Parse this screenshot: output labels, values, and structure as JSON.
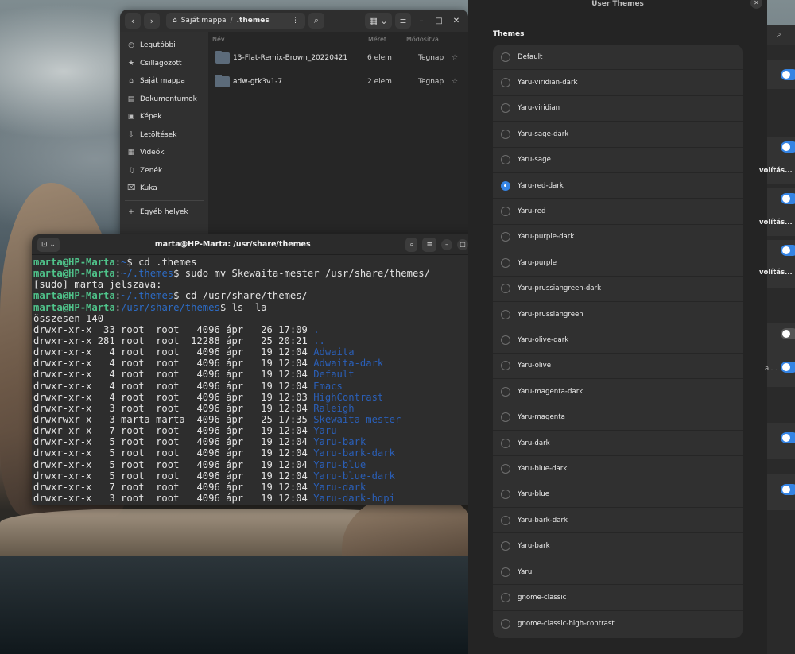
{
  "files": {
    "path_root": "Saját mappa",
    "path_current": ".themes",
    "sidebar": [
      {
        "icon": "clock-icon",
        "glyph": "◷",
        "label": "Legutóbbi"
      },
      {
        "icon": "star-icon",
        "glyph": "★",
        "label": "Csillagozott"
      },
      {
        "icon": "home-icon",
        "glyph": "⌂",
        "label": "Saját mappa"
      },
      {
        "icon": "document-icon",
        "glyph": "▤",
        "label": "Dokumentumok"
      },
      {
        "icon": "image-icon",
        "glyph": "▣",
        "label": "Képek"
      },
      {
        "icon": "download-icon",
        "glyph": "⇩",
        "label": "Letöltések"
      },
      {
        "icon": "video-icon",
        "glyph": "▦",
        "label": "Videók"
      },
      {
        "icon": "music-icon",
        "glyph": "♫",
        "label": "Zenék"
      },
      {
        "icon": "trash-icon",
        "glyph": "⌧",
        "label": "Kuka"
      }
    ],
    "other_places": "Egyéb helyek",
    "columns": {
      "name": "Név",
      "size": "Méret",
      "modified": "Módosítva"
    },
    "rows": [
      {
        "name": "13-Flat-Remix-Brown_20220421",
        "size": "6 elem",
        "modified": "Tegnap"
      },
      {
        "name": "adw-gtk3v1-7",
        "size": "2 elem",
        "modified": "Tegnap"
      }
    ]
  },
  "terminal": {
    "title": "marta@HP-Marta: /usr/share/themes",
    "lines": [
      {
        "user": "marta@HP-Marta",
        "path": "~",
        "cmd": "$ cd .themes"
      },
      {
        "user": "marta@HP-Marta",
        "path": "~/.themes",
        "cmd": "$ sudo mv Skewaita-mester /usr/share/themes/"
      },
      {
        "text": "[sudo] marta jelszava:"
      },
      {
        "user": "marta@HP-Marta",
        "path": "~/.themes",
        "cmd": "$ cd /usr/share/themes/"
      },
      {
        "user": "marta@HP-Marta",
        "path": "/usr/share/themes",
        "cmd": "$ ls -la"
      },
      {
        "text": "összesen 140"
      },
      {
        "text": "drwxr-xr-x  33 root  root   4096 ápr   26 17:09 ",
        "dir": "."
      },
      {
        "text": "drwxr-xr-x 281 root  root  12288 ápr   25 20:21 ",
        "dir": ".."
      },
      {
        "text": "drwxr-xr-x   4 root  root   4096 ápr   19 12:04 ",
        "dir": "Adwaita"
      },
      {
        "text": "drwxr-xr-x   4 root  root   4096 ápr   19 12:04 ",
        "dir": "Adwaita-dark"
      },
      {
        "text": "drwxr-xr-x   4 root  root   4096 ápr   19 12:04 ",
        "dir": "Default"
      },
      {
        "text": "drwxr-xr-x   4 root  root   4096 ápr   19 12:04 ",
        "dir": "Emacs"
      },
      {
        "text": "drwxr-xr-x   4 root  root   4096 ápr   19 12:03 ",
        "dir": "HighContrast"
      },
      {
        "text": "drwxr-xr-x   3 root  root   4096 ápr   19 12:04 ",
        "dir": "Raleigh"
      },
      {
        "text": "drwxrwxr-x   3 marta marta  4096 ápr   25 17:35 ",
        "dir": "Skewaita-mester"
      },
      {
        "text": "drwxr-xr-x   7 root  root   4096 ápr   19 12:04 ",
        "dir": "Yaru"
      },
      {
        "text": "drwxr-xr-x   5 root  root   4096 ápr   19 12:04 ",
        "dir": "Yaru-bark"
      },
      {
        "text": "drwxr-xr-x   5 root  root   4096 ápr   19 12:04 ",
        "dir": "Yaru-bark-dark"
      },
      {
        "text": "drwxr-xr-x   5 root  root   4096 ápr   19 12:04 ",
        "dir": "Yaru-blue"
      },
      {
        "text": "drwxr-xr-x   5 root  root   4096 ápr   19 12:04 ",
        "dir": "Yaru-blue-dark"
      },
      {
        "text": "drwxr-xr-x   7 root  root   4096 ápr   19 12:04 ",
        "dir": "Yaru-dark"
      },
      {
        "text": "drwxr-xr-x   3 root  root   4096 ápr   19 12:04 ",
        "dir": "Yaru-dark-hdpi"
      }
    ]
  },
  "user_themes": {
    "window_title": "User Themes",
    "section_title": "Themes",
    "selected": "Yaru-red-dark",
    "items": [
      "Default",
      "Yaru-viridian-dark",
      "Yaru-viridian",
      "Yaru-sage-dark",
      "Yaru-sage",
      "Yaru-red-dark",
      "Yaru-red",
      "Yaru-purple-dark",
      "Yaru-purple",
      "Yaru-prussiangreen-dark",
      "Yaru-prussiangreen",
      "Yaru-olive-dark",
      "Yaru-olive",
      "Yaru-magenta-dark",
      "Yaru-magenta",
      "Yaru-dark",
      "Yaru-blue-dark",
      "Yaru-blue",
      "Yaru-bark-dark",
      "Yaru-bark",
      "Yaru",
      "gnome-classic",
      "gnome-classic-high-contrast"
    ]
  },
  "settings_partial": {
    "labels": [
      "volítás...",
      "volítás...",
      "volítás...",
      "al..."
    ]
  },
  "colors": {
    "accent": "#3584e4",
    "prompt_user": "#4fc38a",
    "prompt_path": "#2d6cc7"
  }
}
